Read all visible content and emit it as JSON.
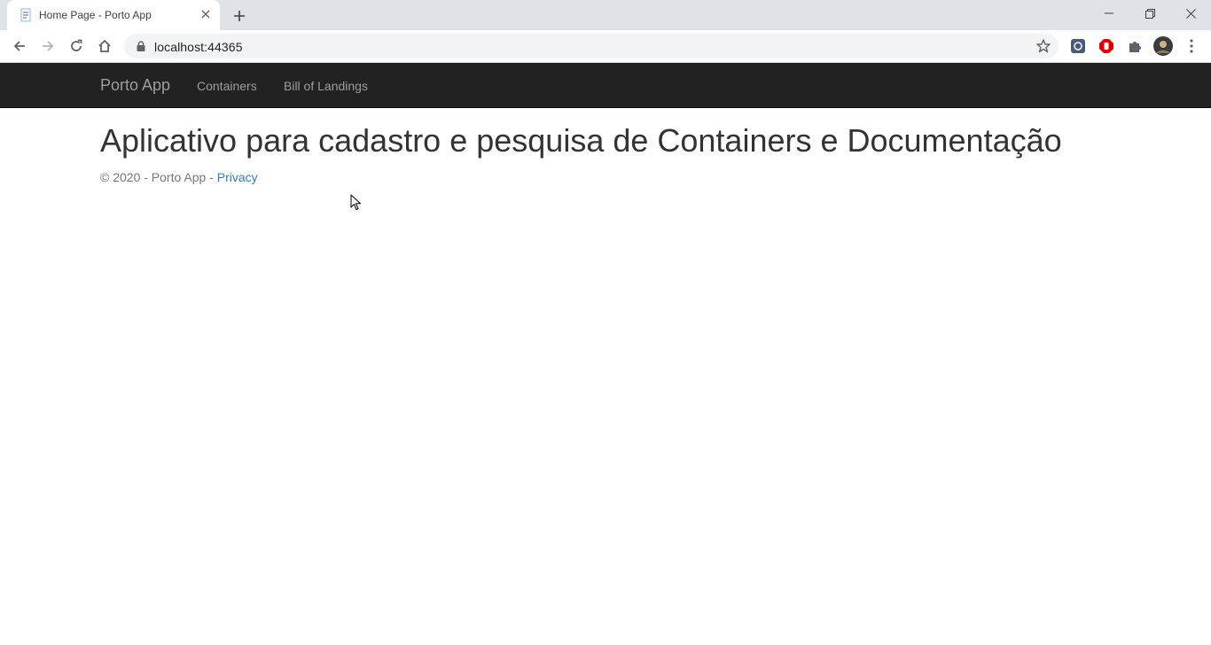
{
  "browser": {
    "tab": {
      "title": "Home Page - Porto App",
      "favicon": "document-icon"
    },
    "address_bar": {
      "url": "localhost:44365"
    },
    "icons": {
      "back": "arrow-left-icon",
      "forward": "arrow-right-icon",
      "reload": "reload-icon",
      "home": "home-icon",
      "lock": "lock-icon",
      "bookmark": "star-icon",
      "extensions": "puzzle-icon",
      "menu": "kebab-menu-icon"
    }
  },
  "navbar": {
    "brand": "Porto App",
    "links": [
      "Containers",
      "Bill of Landings"
    ],
    "background": "#222222",
    "link_color": "#9d9d9d"
  },
  "main": {
    "heading": "Aplicativo para cadastro e pesquisa de Containers e Documentação"
  },
  "footer": {
    "text": "© 2020 - Porto App - ",
    "link": "Privacy",
    "link_color": "#337ab7"
  }
}
